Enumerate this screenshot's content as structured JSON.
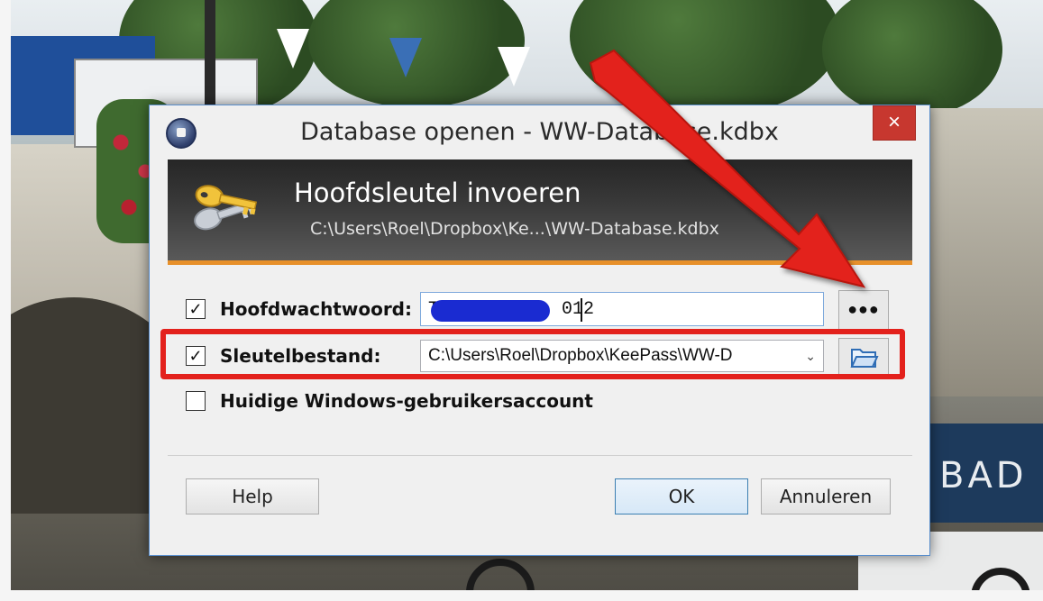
{
  "dialog": {
    "title": "Database openen - WW-Database.kdbx",
    "close_symbol": "×",
    "banner_title": "Hoofdsleutel invoeren",
    "banner_path": "C:\\Users\\Roel\\Dropbox\\Ke...\\WW-Database.kdbx",
    "master_password": {
      "checked": true,
      "check_symbol": "✓",
      "label": "Hoofdwachtwoord:",
      "visible_value_suffix": "012",
      "visible_value_prefix": "T",
      "reveal_button": "●●●"
    },
    "key_file": {
      "checked": true,
      "check_symbol": "✓",
      "label": "Sleutelbestand:",
      "value": "C:\\Users\\Roel\\Dropbox\\KeePass\\WW-D",
      "dropdown_symbol": "⌄"
    },
    "windows_account": {
      "checked": false,
      "check_symbol": "",
      "label": "Huidige Windows-gebruikersaccount"
    },
    "buttons": {
      "help": "Help",
      "ok": "OK",
      "cancel": "Annuleren"
    }
  },
  "background": {
    "boat_text": "BAD"
  },
  "annotations": {
    "arrow_color": "#e3211c",
    "highlight_color": "#e3211c"
  }
}
